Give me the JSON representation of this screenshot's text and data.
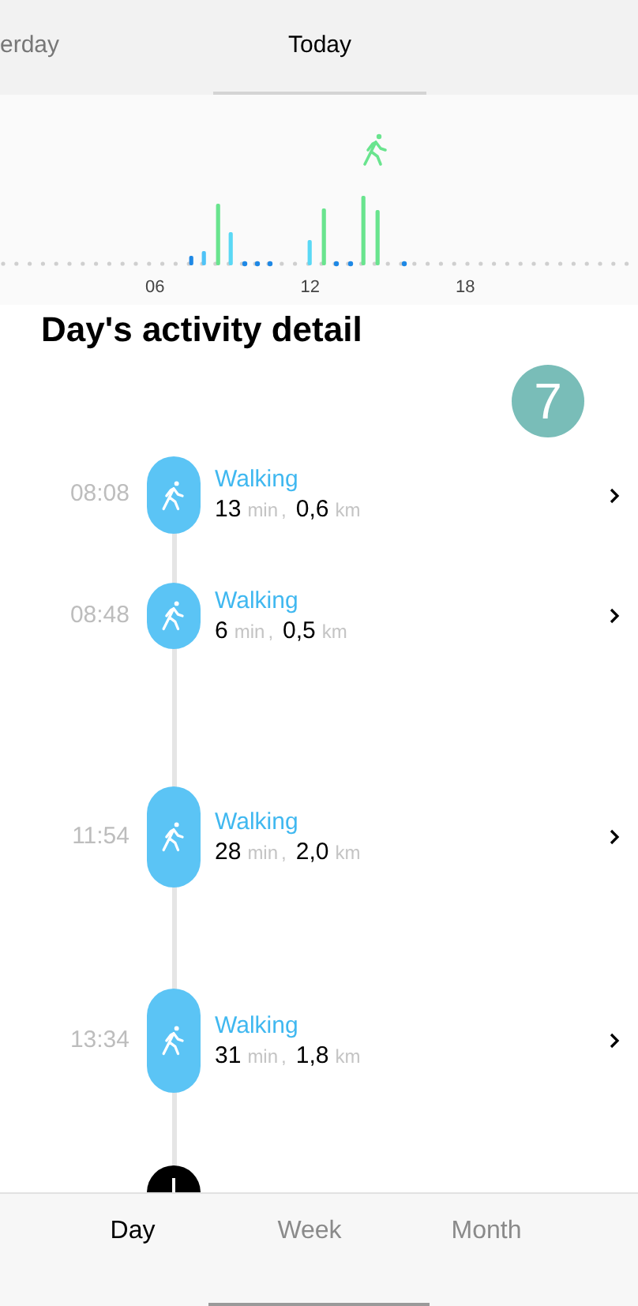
{
  "tabs": [
    {
      "label": "erday",
      "selected": false
    },
    {
      "label": "Today",
      "selected": true
    }
  ],
  "chart": {
    "x_labels": [
      "06",
      "12",
      "18"
    ]
  },
  "title": "Day's activity detail",
  "badge": "7",
  "activities": [
    {
      "time": "08:08",
      "name": "Walking",
      "duration": "13",
      "duration_unit": "min",
      "separator": ",",
      "distance": "0,6",
      "distance_unit": "km"
    },
    {
      "time": "08:48",
      "name": "Walking",
      "duration": "6",
      "duration_unit": "min",
      "separator": ",",
      "distance": "0,5",
      "distance_unit": "km"
    },
    {
      "time": "11:54",
      "name": "Walking",
      "duration": "28",
      "duration_unit": "min",
      "separator": ",",
      "distance": "2,0",
      "distance_unit": "km"
    },
    {
      "time": "13:34",
      "name": "Walking",
      "duration": "31",
      "duration_unit": "min",
      "separator": ",",
      "distance": "1,8",
      "distance_unit": "km"
    }
  ],
  "bottom_tabs": [
    {
      "label": "Day",
      "selected": true
    },
    {
      "label": "Week",
      "selected": false
    },
    {
      "label": "Month",
      "selected": false
    }
  ]
}
